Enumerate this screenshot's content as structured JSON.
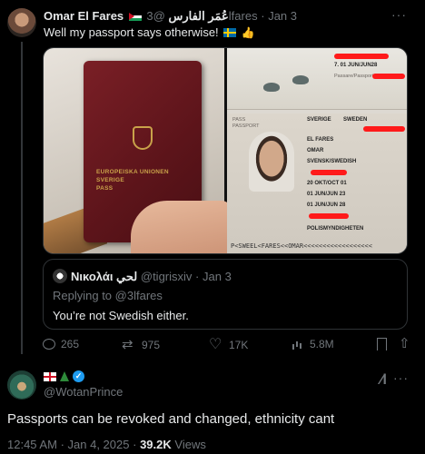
{
  "original_post": {
    "display_name": "Omar El Fares",
    "arabic_name": "عُمَر الفارس",
    "handle": "@3lfares",
    "separator": "·",
    "date": "Jan 3",
    "text": "Well my passport says otherwise!",
    "media": {
      "cover_text": [
        "EUROPEISKA UNIONEN",
        "SVERIGE",
        "PASS"
      ],
      "passport_fields": {
        "date_header": "7. 01 JUN/JUN28",
        "signature_label": "Passare/Passport No.",
        "type_label": "PASS",
        "type_label_en": "PASSPORT",
        "country": "SVERIGE",
        "country_en": "SWEDEN",
        "surname": "EL FARES",
        "given_name": "OMAR",
        "nationality": "SVENSK/SWEDISH",
        "birth_date": "20 OKT/OCT 01",
        "issue_date": "01 JUN/JUN 23",
        "expiry_date": "01 JUN/JUN 28",
        "authority": "POLISMYNDIGHETEN",
        "mrz": "P<SWEEL<FARES<<OMAR<<<<<<<<<<<<<<<<<<"
      }
    },
    "quote": {
      "display_name": "Νικολάι لحي",
      "handle": "@tigrisxiv",
      "date": "Jan 3",
      "replying_to_label": "Replying to",
      "replying_to_handle": "@3lfares",
      "text": "You’re not Swedish either."
    },
    "actions": {
      "replies": "265",
      "reposts": "975",
      "likes": "17K",
      "views": "5.8M"
    },
    "icons": [
      "reply-icon",
      "repost-icon",
      "like-icon",
      "views-icon",
      "bookmark-icon",
      "share-icon",
      "more-icon"
    ]
  },
  "reply_post": {
    "handle": "@WotanPrince",
    "text": "Passports can be revoked and changed, ethnicity cant",
    "time": "12:45 AM",
    "separator": "·",
    "date": "Jan 4, 2025",
    "views_count": "39.2K",
    "views_label": "Views",
    "verified_color": "#1d9bf0"
  }
}
